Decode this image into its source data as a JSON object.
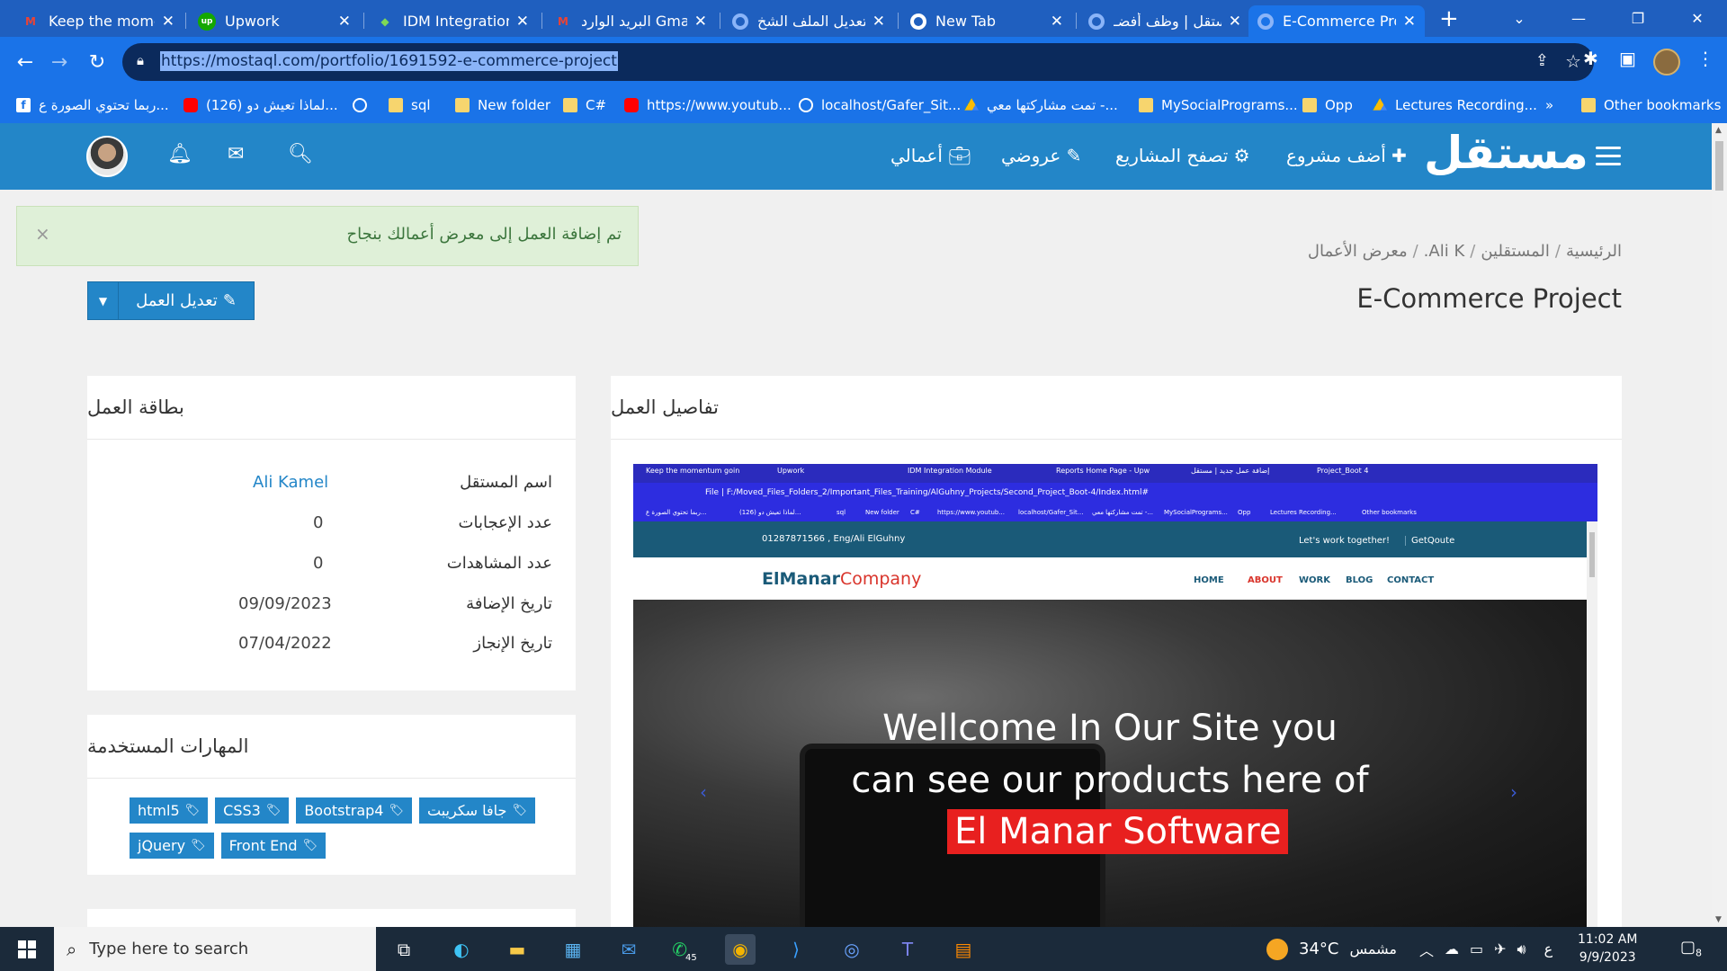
{
  "browser": {
    "tabs": [
      {
        "title": "Keep the moment",
        "icon": "gmail-icon"
      },
      {
        "title": "Upwork",
        "icon": "upwork-icon"
      },
      {
        "title": "IDM Integration M",
        "icon": "idm-icon"
      },
      {
        "title": "البريد الوارد Gmail",
        "icon": "gmail-icon"
      },
      {
        "title": "تعديل الملف الشخ",
        "icon": "mostaql-icon"
      },
      {
        "title": "New Tab",
        "icon": "chrome-icon"
      },
      {
        "title": "مستقل | وظف أفضـ",
        "icon": "mostaql-icon"
      },
      {
        "title": "E-Commerce Proj",
        "icon": "mostaql-icon"
      }
    ],
    "url": "https://mostaql.com/portfolio/1691592-e-commerce-project",
    "bookmarks": [
      "ربما تحتوي الصورة ع...",
      "(126) لماذا تعيش دو...",
      "sql",
      "New folder",
      "C#",
      "https://www.youtub...",
      "localhost/Gafer_Sit...",
      "تمت مشاركتها معي -...",
      "MySocialPrograms...",
      "Opp",
      "Lectures Recording...",
      "»",
      "Other bookmarks"
    ]
  },
  "site": {
    "logo": "مستقل",
    "nav": {
      "add_project": "أضف مشروع",
      "browse_projects": "تصفح المشاريع",
      "my_offers": "عروضي",
      "my_works": "أعمالي"
    },
    "alert": "تم إضافة العمل إلى معرض أعمالك بنجاح",
    "alert_close": "×",
    "breadcrumb": [
      "الرئيسية",
      "المستقلين",
      "Ali K.",
      "معرض الأعمال"
    ],
    "breadcrumb_sep": "/",
    "title": "E-Commerce Project",
    "edit_button": "تعديل العمل",
    "details_card": {
      "title": "تفاصيل العمل"
    },
    "info_card": {
      "title": "بطاقة العمل",
      "rows": [
        {
          "label": "اسم المستقل",
          "value": "Ali Kamel"
        },
        {
          "label": "عدد الإعجابات",
          "value": "0"
        },
        {
          "label": "عدد المشاهدات",
          "value": "0"
        },
        {
          "label": "تاريخ الإضافة",
          "value": "09/09/2023"
        },
        {
          "label": "تاريخ الإنجاز",
          "value": "07/04/2022"
        }
      ]
    },
    "skills_card": {
      "title": "المهارات المستخدمة",
      "skills": [
        "جافا سكريبت",
        "Bootstrap4",
        "CSS3",
        "html5",
        "Front End",
        "jQuery"
      ]
    }
  },
  "screenshot": {
    "tabs": [
      "Keep the momentum goin",
      "Upwork",
      "IDM Integration Module",
      "Reports Home Page - Upw",
      "إضافة عمل جديد | مستقل",
      "Project_Boot 4"
    ],
    "url": "File | F:/Moved_Files_Folders_2/Important_Files_Training/AlGuhny_Projects/Second_Project_Boot-4/Index.html#",
    "bookmarks": [
      "ربما تحتوي الصورة ع...",
      "(126) لماذا تعيش دو...",
      "sql",
      "New folder",
      "C#",
      "https://www.youtub...",
      "localhost/Gafer_Sit...",
      "تمت مشاركتها معي -...",
      "MySocialPrograms...",
      "Opp",
      "Lectures Recording...",
      "Other bookmarks"
    ],
    "contact": "01287871566 , Eng/Ali ElGuhny",
    "work_together": "Let's work together!",
    "get_quote": "GetQoute",
    "brand_1": "ElManar",
    "brand_2": "Company",
    "menu": [
      "HOME",
      "ABOUT",
      "WORK",
      "BLOG",
      "CONTACT"
    ],
    "hero_line1": "Wellcome In Our Site you",
    "hero_line2": "can see our products here of",
    "hero_line3": "El Manar Software"
  },
  "taskbar": {
    "search_placeholder": "Type here to search",
    "whatsapp_badge": "45",
    "weather": "34°C",
    "weather_text": "مشمس",
    "lang": "ع",
    "time": "11:02 AM",
    "date": "9/9/2023",
    "notifications": "8"
  }
}
